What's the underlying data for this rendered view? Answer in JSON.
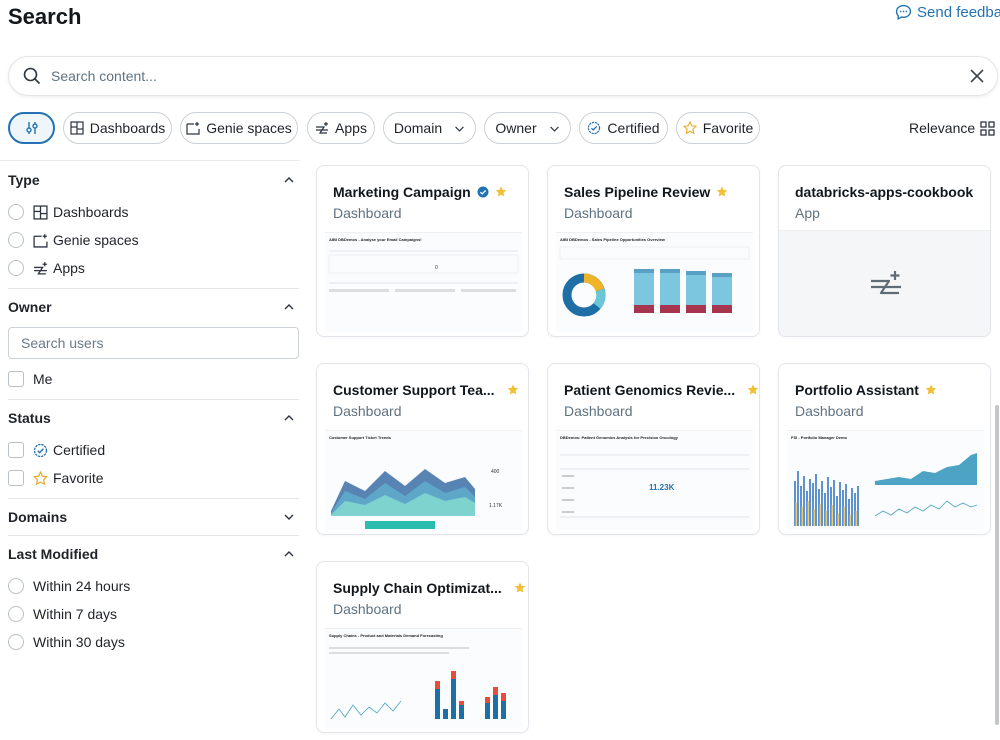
{
  "page": {
    "title": "Search",
    "feedback_label": "Send feedback"
  },
  "search": {
    "placeholder": "Search content..."
  },
  "filters": {
    "dashboards": "Dashboards",
    "genie": "Genie spaces",
    "apps": "Apps",
    "domain": "Domain",
    "owner": "Owner",
    "certified": "Certified",
    "favorite": "Favorite"
  },
  "sort": {
    "label": "Relevance"
  },
  "sidebar": {
    "type": {
      "title": "Type",
      "options": [
        "Dashboards",
        "Genie spaces",
        "Apps"
      ]
    },
    "owner": {
      "title": "Owner",
      "placeholder": "Search users",
      "me": "Me"
    },
    "status": {
      "title": "Status",
      "certified": "Certified",
      "favorite": "Favorite"
    },
    "domains": {
      "title": "Domains"
    },
    "last_modified": {
      "title": "Last Modified",
      "options": [
        "Within 24 hours",
        "Within 7 days",
        "Within 30 days"
      ]
    }
  },
  "results": [
    {
      "title": "Marketing Campaign",
      "type": "Dashboard",
      "certified": true,
      "favorite": true,
      "preview_title": "AIBI DBDemos - Analyse your Email Campaigns!"
    },
    {
      "title": "Sales Pipeline Review",
      "type": "Dashboard",
      "certified": false,
      "favorite": true,
      "preview_title": "AIBI DBDemos - Sales Pipeline Opportunities Overview"
    },
    {
      "title": "databricks-apps-cookbook",
      "type": "App",
      "certified": false,
      "favorite": false
    },
    {
      "title": "Customer Support Tea...",
      "type": "Dashboard",
      "certified": false,
      "favorite": true,
      "preview_title": "Customer Support Ticket Trends"
    },
    {
      "title": "Patient Genomics Revie...",
      "type": "Dashboard",
      "certified": false,
      "favorite": true,
      "preview_title": "DBDemos: Patient Genomics Analysis for Precision Oncology",
      "preview_metric": "11.23K"
    },
    {
      "title": "Portfolio Assistant",
      "type": "Dashboard",
      "certified": false,
      "favorite": true,
      "preview_title": "FSI - Portfolio Manager Demo"
    },
    {
      "title": "Supply Chain Optimizat...",
      "type": "Dashboard",
      "certified": false,
      "favorite": true,
      "preview_title": "Supply Chains - Product and Materials Demand Forecasting"
    }
  ],
  "colors": {
    "accent": "#2272b4",
    "star": "#f2c037",
    "certified": "#2272b4"
  }
}
